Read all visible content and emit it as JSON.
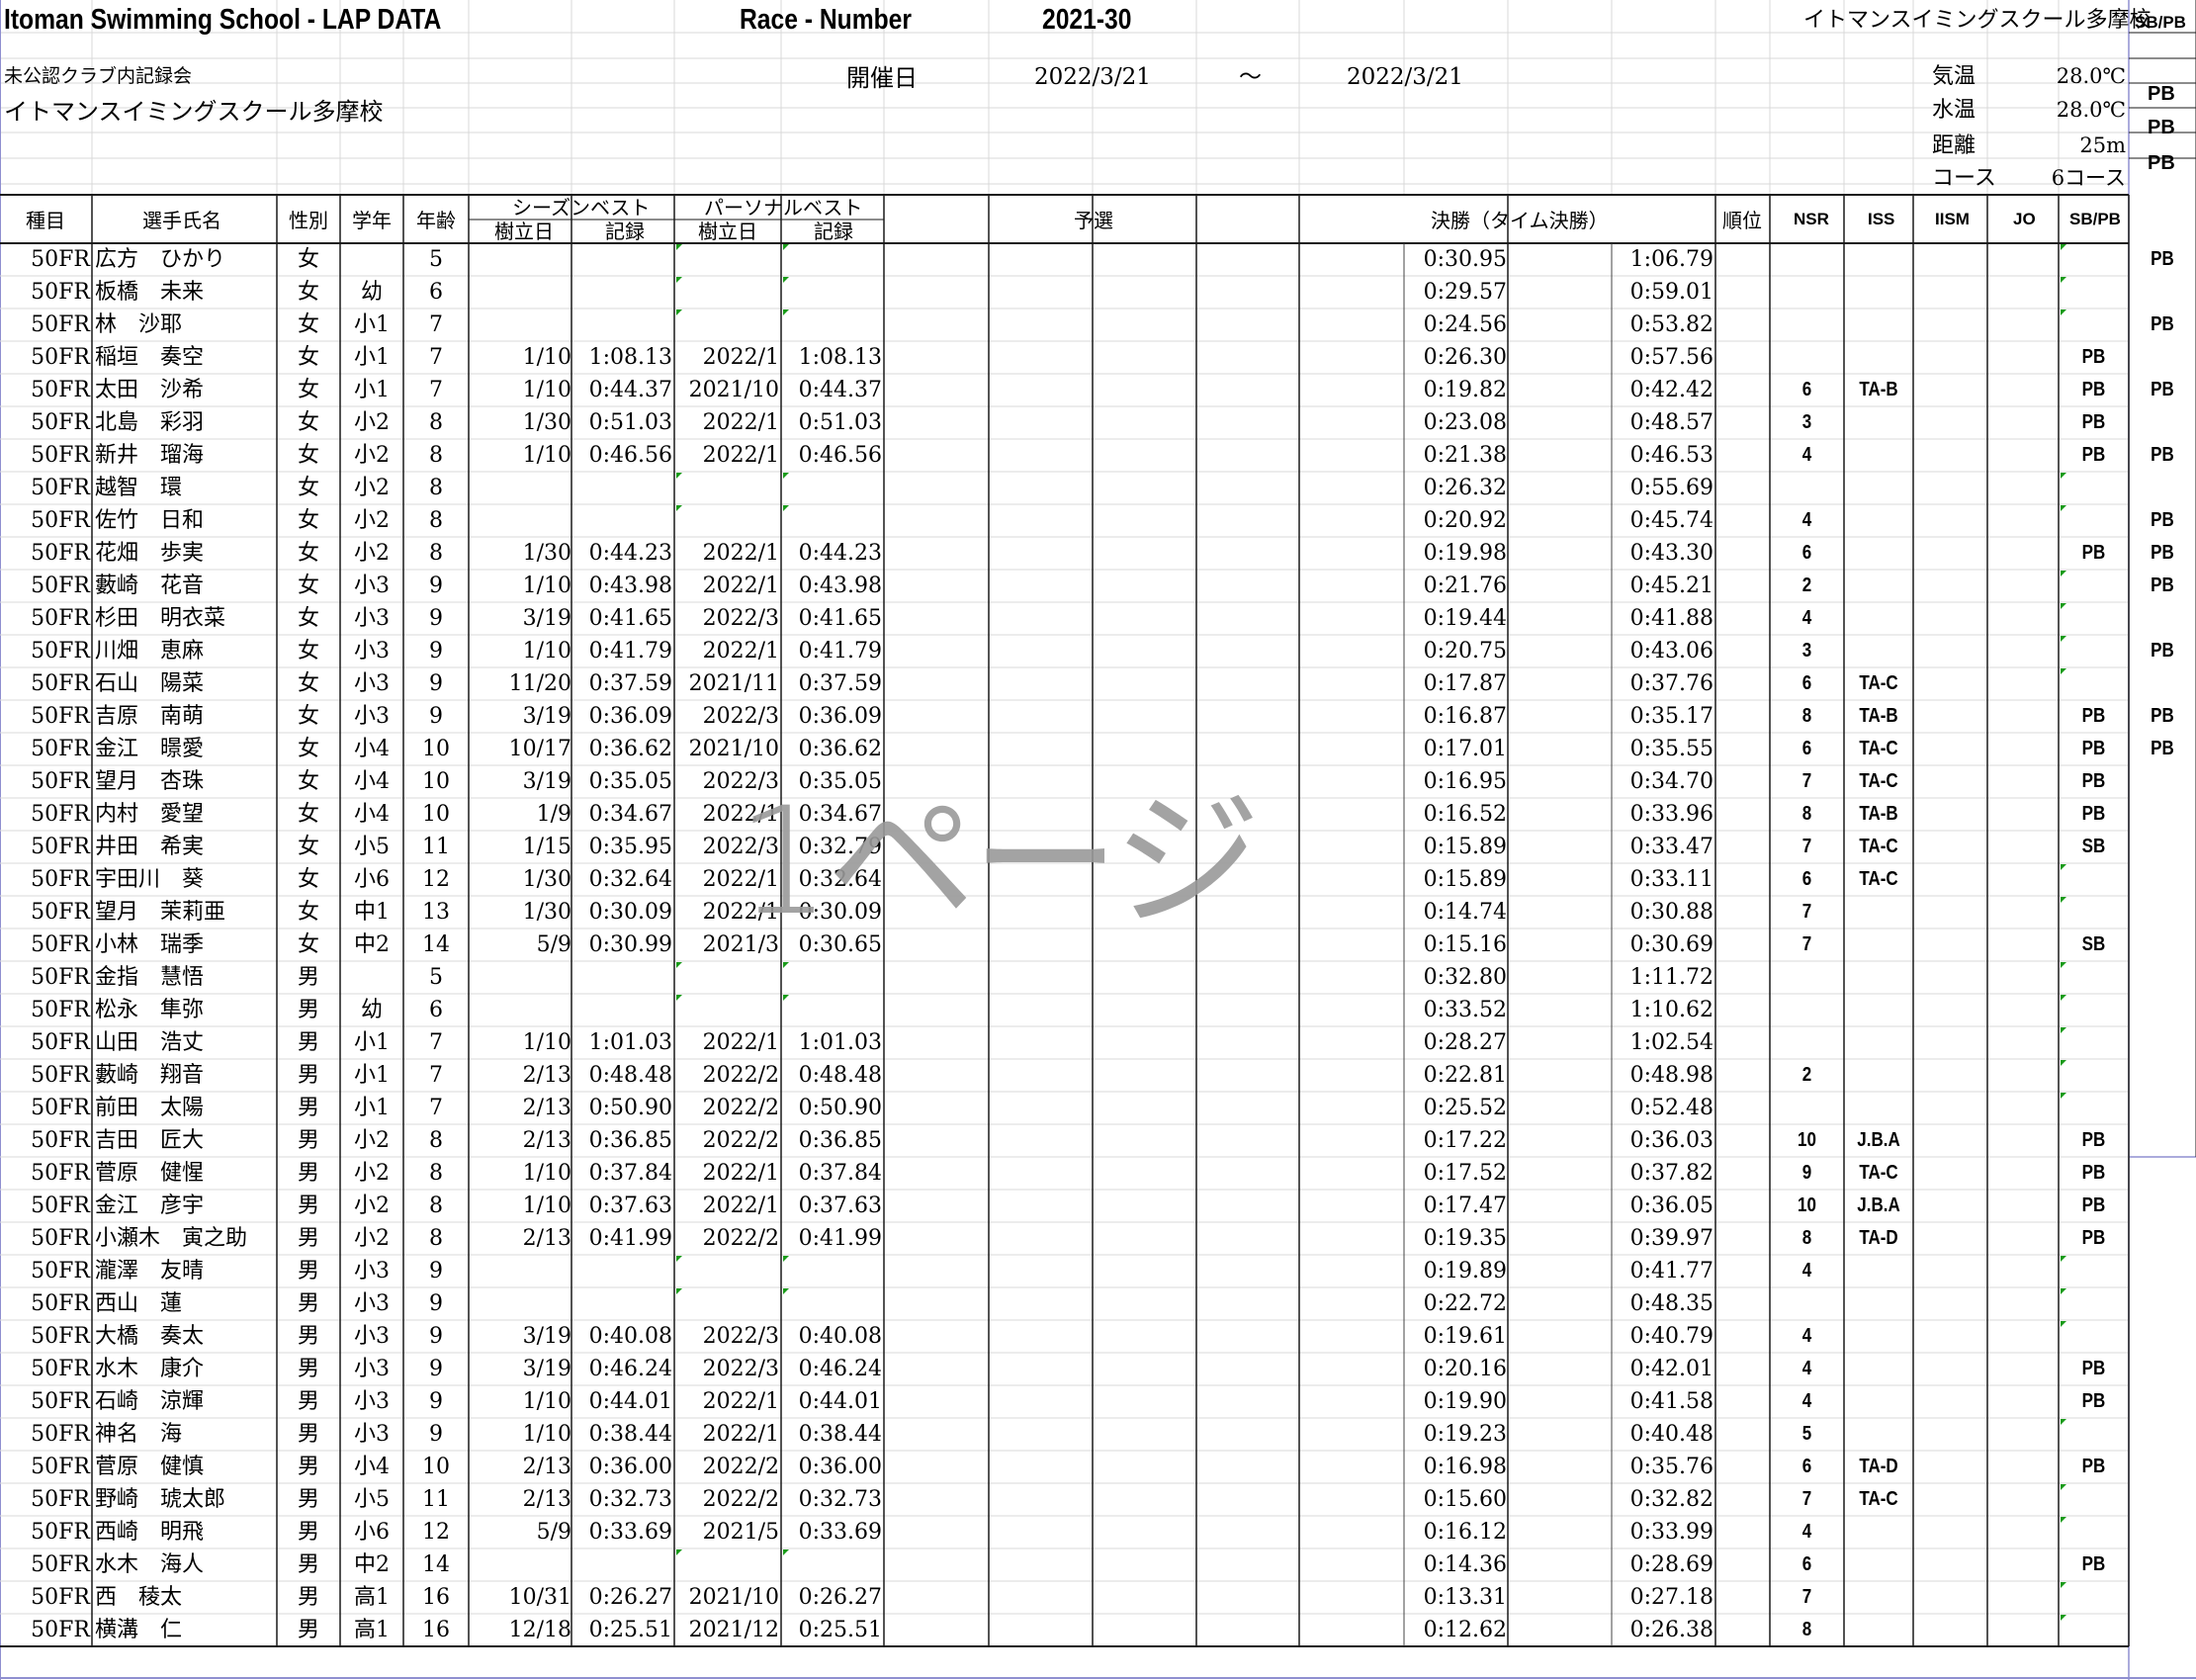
{
  "header": {
    "title": "Itoman Swimming School - LAP DATA",
    "race_label": "Race - Number",
    "race_number": "2021-30",
    "school_top_right": "イトマンスイミングスクール多摩校",
    "sbpb_label": "SB/PB",
    "meet_name": "未公認クラブ内記録会",
    "school_name": "イトマンスイミングスクール多摩校",
    "date_label": "開催日",
    "date_from": "2022/3/21",
    "tilde": "～",
    "date_to": "2022/3/21",
    "conditions": [
      {
        "label": "気温",
        "value": "28.0℃",
        "mark": "PB"
      },
      {
        "label": "水温",
        "value": "28.0℃",
        "mark": "PB"
      },
      {
        "label": "距離",
        "value": "25m",
        "mark": "PB"
      },
      {
        "label": "コース",
        "value": "6コース",
        "mark": ""
      }
    ]
  },
  "columns": {
    "event": "種目",
    "name": "選手氏名",
    "sex": "性別",
    "grade": "学年",
    "age": "年齢",
    "season_best": "シーズンベスト",
    "personal_best": "パーソナルベスト",
    "set_date": "樹立日",
    "record": "記録",
    "prelim": "予選",
    "final": "決勝（タイム決勝）",
    "rank": "順位",
    "nsr": "NSR",
    "iss": "ISS",
    "iism": "IISM",
    "jo": "JO",
    "sbpb": "SB/PB"
  },
  "watermark": "1ページ",
  "rows": [
    {
      "event": "50FR",
      "name": "広方　ひかり",
      "sex": "女",
      "grade": "",
      "age": "5",
      "sb_date": "",
      "sb_time": "",
      "pb_date": "",
      "pb_time": "",
      "split": "0:30.95",
      "final": "1:06.79",
      "nsr": "",
      "iss": "",
      "sbpb": "",
      "side": "PB"
    },
    {
      "event": "50FR",
      "name": "板橋　未来",
      "sex": "女",
      "grade": "幼",
      "age": "6",
      "sb_date": "",
      "sb_time": "",
      "pb_date": "",
      "pb_time": "",
      "split": "0:29.57",
      "final": "0:59.01",
      "nsr": "",
      "iss": "",
      "sbpb": "",
      "side": ""
    },
    {
      "event": "50FR",
      "name": "林　沙耶",
      "sex": "女",
      "grade": "小1",
      "age": "7",
      "sb_date": "",
      "sb_time": "",
      "pb_date": "",
      "pb_time": "",
      "split": "0:24.56",
      "final": "0:53.82",
      "nsr": "",
      "iss": "",
      "sbpb": "",
      "side": "PB"
    },
    {
      "event": "50FR",
      "name": "稲垣　奏空",
      "sex": "女",
      "grade": "小1",
      "age": "7",
      "sb_date": "1/10",
      "sb_time": "1:08.13",
      "pb_date": "2022/1",
      "pb_time": "1:08.13",
      "split": "0:26.30",
      "final": "0:57.56",
      "nsr": "",
      "iss": "",
      "sbpb": "PB",
      "side": ""
    },
    {
      "event": "50FR",
      "name": "太田　沙希",
      "sex": "女",
      "grade": "小1",
      "age": "7",
      "sb_date": "1/10",
      "sb_time": "0:44.37",
      "pb_date": "2021/10",
      "pb_time": "0:44.37",
      "split": "0:19.82",
      "final": "0:42.42",
      "nsr": "6",
      "iss": "TA-B",
      "sbpb": "PB",
      "side": "PB"
    },
    {
      "event": "50FR",
      "name": "北島　彩羽",
      "sex": "女",
      "grade": "小2",
      "age": "8",
      "sb_date": "1/30",
      "sb_time": "0:51.03",
      "pb_date": "2022/1",
      "pb_time": "0:51.03",
      "split": "0:23.08",
      "final": "0:48.57",
      "nsr": "3",
      "iss": "",
      "sbpb": "PB",
      "side": ""
    },
    {
      "event": "50FR",
      "name": "新井　瑠海",
      "sex": "女",
      "grade": "小2",
      "age": "8",
      "sb_date": "1/10",
      "sb_time": "0:46.56",
      "pb_date": "2022/1",
      "pb_time": "0:46.56",
      "split": "0:21.38",
      "final": "0:46.53",
      "nsr": "4",
      "iss": "",
      "sbpb": "PB",
      "side": "PB"
    },
    {
      "event": "50FR",
      "name": "越智　環",
      "sex": "女",
      "grade": "小2",
      "age": "8",
      "sb_date": "",
      "sb_time": "",
      "pb_date": "",
      "pb_time": "",
      "split": "0:26.32",
      "final": "0:55.69",
      "nsr": "",
      "iss": "",
      "sbpb": "",
      "side": ""
    },
    {
      "event": "50FR",
      "name": "佐竹　日和",
      "sex": "女",
      "grade": "小2",
      "age": "8",
      "sb_date": "",
      "sb_time": "",
      "pb_date": "",
      "pb_time": "",
      "split": "0:20.92",
      "final": "0:45.74",
      "nsr": "4",
      "iss": "",
      "sbpb": "",
      "side": "PB"
    },
    {
      "event": "50FR",
      "name": "花畑　歩実",
      "sex": "女",
      "grade": "小2",
      "age": "8",
      "sb_date": "1/30",
      "sb_time": "0:44.23",
      "pb_date": "2022/1",
      "pb_time": "0:44.23",
      "split": "0:19.98",
      "final": "0:43.30",
      "nsr": "6",
      "iss": "",
      "sbpb": "PB",
      "side": "PB"
    },
    {
      "event": "50FR",
      "name": "藪崎　花音",
      "sex": "女",
      "grade": "小3",
      "age": "9",
      "sb_date": "1/10",
      "sb_time": "0:43.98",
      "pb_date": "2022/1",
      "pb_time": "0:43.98",
      "split": "0:21.76",
      "final": "0:45.21",
      "nsr": "2",
      "iss": "",
      "sbpb": "",
      "side": "PB"
    },
    {
      "event": "50FR",
      "name": "杉田　明衣菜",
      "sex": "女",
      "grade": "小3",
      "age": "9",
      "sb_date": "3/19",
      "sb_time": "0:41.65",
      "pb_date": "2022/3",
      "pb_time": "0:41.65",
      "split": "0:19.44",
      "final": "0:41.88",
      "nsr": "4",
      "iss": "",
      "sbpb": "",
      "side": ""
    },
    {
      "event": "50FR",
      "name": "川畑　恵麻",
      "sex": "女",
      "grade": "小3",
      "age": "9",
      "sb_date": "1/10",
      "sb_time": "0:41.79",
      "pb_date": "2022/1",
      "pb_time": "0:41.79",
      "split": "0:20.75",
      "final": "0:43.06",
      "nsr": "3",
      "iss": "",
      "sbpb": "",
      "side": "PB"
    },
    {
      "event": "50FR",
      "name": "石山　陽菜",
      "sex": "女",
      "grade": "小3",
      "age": "9",
      "sb_date": "11/20",
      "sb_time": "0:37.59",
      "pb_date": "2021/11",
      "pb_time": "0:37.59",
      "split": "0:17.87",
      "final": "0:37.76",
      "nsr": "6",
      "iss": "TA-C",
      "sbpb": "",
      "side": ""
    },
    {
      "event": "50FR",
      "name": "吉原　南萌",
      "sex": "女",
      "grade": "小3",
      "age": "9",
      "sb_date": "3/19",
      "sb_time": "0:36.09",
      "pb_date": "2022/3",
      "pb_time": "0:36.09",
      "split": "0:16.87",
      "final": "0:35.17",
      "nsr": "8",
      "iss": "TA-B",
      "sbpb": "PB",
      "side": "PB"
    },
    {
      "event": "50FR",
      "name": "金江　暻愛",
      "sex": "女",
      "grade": "小4",
      "age": "10",
      "sb_date": "10/17",
      "sb_time": "0:36.62",
      "pb_date": "2021/10",
      "pb_time": "0:36.62",
      "split": "0:17.01",
      "final": "0:35.55",
      "nsr": "6",
      "iss": "TA-C",
      "sbpb": "PB",
      "side": "PB"
    },
    {
      "event": "50FR",
      "name": "望月　杏珠",
      "sex": "女",
      "grade": "小4",
      "age": "10",
      "sb_date": "3/19",
      "sb_time": "0:35.05",
      "pb_date": "2022/3",
      "pb_time": "0:35.05",
      "split": "0:16.95",
      "final": "0:34.70",
      "nsr": "7",
      "iss": "TA-C",
      "sbpb": "PB",
      "side": ""
    },
    {
      "event": "50FR",
      "name": "内村　愛望",
      "sex": "女",
      "grade": "小4",
      "age": "10",
      "sb_date": "1/9",
      "sb_time": "0:34.67",
      "pb_date": "2022/1",
      "pb_time": "0:34.67",
      "split": "0:16.52",
      "final": "0:33.96",
      "nsr": "8",
      "iss": "TA-B",
      "sbpb": "PB",
      "side": ""
    },
    {
      "event": "50FR",
      "name": "井田　希実",
      "sex": "女",
      "grade": "小5",
      "age": "11",
      "sb_date": "1/15",
      "sb_time": "0:35.95",
      "pb_date": "2022/3",
      "pb_time": "0:32.79",
      "split": "0:15.89",
      "final": "0:33.47",
      "nsr": "7",
      "iss": "TA-C",
      "sbpb": "SB",
      "side": ""
    },
    {
      "event": "50FR",
      "name": "宇田川　葵",
      "sex": "女",
      "grade": "小6",
      "age": "12",
      "sb_date": "1/30",
      "sb_time": "0:32.64",
      "pb_date": "2022/1",
      "pb_time": "0:32.64",
      "split": "0:15.89",
      "final": "0:33.11",
      "nsr": "6",
      "iss": "TA-C",
      "sbpb": "",
      "side": ""
    },
    {
      "event": "50FR",
      "name": "望月　茉莉亜",
      "sex": "女",
      "grade": "中1",
      "age": "13",
      "sb_date": "1/30",
      "sb_time": "0:30.09",
      "pb_date": "2022/1",
      "pb_time": "0:30.09",
      "split": "0:14.74",
      "final": "0:30.88",
      "nsr": "7",
      "iss": "",
      "sbpb": "",
      "side": ""
    },
    {
      "event": "50FR",
      "name": "小林　瑞季",
      "sex": "女",
      "grade": "中2",
      "age": "14",
      "sb_date": "5/9",
      "sb_time": "0:30.99",
      "pb_date": "2021/3",
      "pb_time": "0:30.65",
      "split": "0:15.16",
      "final": "0:30.69",
      "nsr": "7",
      "iss": "",
      "sbpb": "SB",
      "side": ""
    },
    {
      "event": "50FR",
      "name": "金指　慧悟",
      "sex": "男",
      "grade": "",
      "age": "5",
      "sb_date": "",
      "sb_time": "",
      "pb_date": "",
      "pb_time": "",
      "split": "0:32.80",
      "final": "1:11.72",
      "nsr": "",
      "iss": "",
      "sbpb": "",
      "side": ""
    },
    {
      "event": "50FR",
      "name": "松永　隼弥",
      "sex": "男",
      "grade": "幼",
      "age": "6",
      "sb_date": "",
      "sb_time": "",
      "pb_date": "",
      "pb_time": "",
      "split": "0:33.52",
      "final": "1:10.62",
      "nsr": "",
      "iss": "",
      "sbpb": "",
      "side": ""
    },
    {
      "event": "50FR",
      "name": "山田　浩丈",
      "sex": "男",
      "grade": "小1",
      "age": "7",
      "sb_date": "1/10",
      "sb_time": "1:01.03",
      "pb_date": "2022/1",
      "pb_time": "1:01.03",
      "split": "0:28.27",
      "final": "1:02.54",
      "nsr": "",
      "iss": "",
      "sbpb": "",
      "side": ""
    },
    {
      "event": "50FR",
      "name": "藪崎　翔音",
      "sex": "男",
      "grade": "小1",
      "age": "7",
      "sb_date": "2/13",
      "sb_time": "0:48.48",
      "pb_date": "2022/2",
      "pb_time": "0:48.48",
      "split": "0:22.81",
      "final": "0:48.98",
      "nsr": "2",
      "iss": "",
      "sbpb": "",
      "side": ""
    },
    {
      "event": "50FR",
      "name": "前田　太陽",
      "sex": "男",
      "grade": "小1",
      "age": "7",
      "sb_date": "2/13",
      "sb_time": "0:50.90",
      "pb_date": "2022/2",
      "pb_time": "0:50.90",
      "split": "0:25.52",
      "final": "0:52.48",
      "nsr": "",
      "iss": "",
      "sbpb": "",
      "side": ""
    },
    {
      "event": "50FR",
      "name": "吉田　匠大",
      "sex": "男",
      "grade": "小2",
      "age": "8",
      "sb_date": "2/13",
      "sb_time": "0:36.85",
      "pb_date": "2022/2",
      "pb_time": "0:36.85",
      "split": "0:17.22",
      "final": "0:36.03",
      "nsr": "10",
      "iss": "J.B.A",
      "sbpb": "PB",
      "side": ""
    },
    {
      "event": "50FR",
      "name": "菅原　健惺",
      "sex": "男",
      "grade": "小2",
      "age": "8",
      "sb_date": "1/10",
      "sb_time": "0:37.84",
      "pb_date": "2022/1",
      "pb_time": "0:37.84",
      "split": "0:17.52",
      "final": "0:37.82",
      "nsr": "9",
      "iss": "TA-C",
      "sbpb": "PB",
      "side": ""
    },
    {
      "event": "50FR",
      "name": "金江　彦宇",
      "sex": "男",
      "grade": "小2",
      "age": "8",
      "sb_date": "1/10",
      "sb_time": "0:37.63",
      "pb_date": "2022/1",
      "pb_time": "0:37.63",
      "split": "0:17.47",
      "final": "0:36.05",
      "nsr": "10",
      "iss": "J.B.A",
      "sbpb": "PB",
      "side": ""
    },
    {
      "event": "50FR",
      "name": "小瀬木　寅之助",
      "sex": "男",
      "grade": "小2",
      "age": "8",
      "sb_date": "2/13",
      "sb_time": "0:41.99",
      "pb_date": "2022/2",
      "pb_time": "0:41.99",
      "split": "0:19.35",
      "final": "0:39.97",
      "nsr": "8",
      "iss": "TA-D",
      "sbpb": "PB",
      "side": ""
    },
    {
      "event": "50FR",
      "name": "瀧澤　友晴",
      "sex": "男",
      "grade": "小3",
      "age": "9",
      "sb_date": "",
      "sb_time": "",
      "pb_date": "",
      "pb_time": "",
      "split": "0:19.89",
      "final": "0:41.77",
      "nsr": "4",
      "iss": "",
      "sbpb": "",
      "side": ""
    },
    {
      "event": "50FR",
      "name": "西山　蓮",
      "sex": "男",
      "grade": "小3",
      "age": "9",
      "sb_date": "",
      "sb_time": "",
      "pb_date": "",
      "pb_time": "",
      "split": "0:22.72",
      "final": "0:48.35",
      "nsr": "",
      "iss": "",
      "sbpb": "",
      "side": ""
    },
    {
      "event": "50FR",
      "name": "大橋　奏太",
      "sex": "男",
      "grade": "小3",
      "age": "9",
      "sb_date": "3/19",
      "sb_time": "0:40.08",
      "pb_date": "2022/3",
      "pb_time": "0:40.08",
      "split": "0:19.61",
      "final": "0:40.79",
      "nsr": "4",
      "iss": "",
      "sbpb": "",
      "side": ""
    },
    {
      "event": "50FR",
      "name": "水木　康介",
      "sex": "男",
      "grade": "小3",
      "age": "9",
      "sb_date": "3/19",
      "sb_time": "0:46.24",
      "pb_date": "2022/3",
      "pb_time": "0:46.24",
      "split": "0:20.16",
      "final": "0:42.01",
      "nsr": "4",
      "iss": "",
      "sbpb": "PB",
      "side": ""
    },
    {
      "event": "50FR",
      "name": "石崎　涼輝",
      "sex": "男",
      "grade": "小3",
      "age": "9",
      "sb_date": "1/10",
      "sb_time": "0:44.01",
      "pb_date": "2022/1",
      "pb_time": "0:44.01",
      "split": "0:19.90",
      "final": "0:41.58",
      "nsr": "4",
      "iss": "",
      "sbpb": "PB",
      "side": ""
    },
    {
      "event": "50FR",
      "name": "神名　海",
      "sex": "男",
      "grade": "小3",
      "age": "9",
      "sb_date": "1/10",
      "sb_time": "0:38.44",
      "pb_date": "2022/1",
      "pb_time": "0:38.44",
      "split": "0:19.23",
      "final": "0:40.48",
      "nsr": "5",
      "iss": "",
      "sbpb": "",
      "side": ""
    },
    {
      "event": "50FR",
      "name": "菅原　健慎",
      "sex": "男",
      "grade": "小4",
      "age": "10",
      "sb_date": "2/13",
      "sb_time": "0:36.00",
      "pb_date": "2022/2",
      "pb_time": "0:36.00",
      "split": "0:16.98",
      "final": "0:35.76",
      "nsr": "6",
      "iss": "TA-D",
      "sbpb": "PB",
      "side": ""
    },
    {
      "event": "50FR",
      "name": "野崎　琥太郎",
      "sex": "男",
      "grade": "小5",
      "age": "11",
      "sb_date": "2/13",
      "sb_time": "0:32.73",
      "pb_date": "2022/2",
      "pb_time": "0:32.73",
      "split": "0:15.60",
      "final": "0:32.82",
      "nsr": "7",
      "iss": "TA-C",
      "sbpb": "",
      "side": ""
    },
    {
      "event": "50FR",
      "name": "西崎　明飛",
      "sex": "男",
      "grade": "小6",
      "age": "12",
      "sb_date": "5/9",
      "sb_time": "0:33.69",
      "pb_date": "2021/5",
      "pb_time": "0:33.69",
      "split": "0:16.12",
      "final": "0:33.99",
      "nsr": "4",
      "iss": "",
      "sbpb": "",
      "side": ""
    },
    {
      "event": "50FR",
      "name": "水木　海人",
      "sex": "男",
      "grade": "中2",
      "age": "14",
      "sb_date": "",
      "sb_time": "",
      "pb_date": "",
      "pb_time": "",
      "split": "0:14.36",
      "final": "0:28.69",
      "nsr": "6",
      "iss": "",
      "sbpb": "PB",
      "side": ""
    },
    {
      "event": "50FR",
      "name": "西　稜太",
      "sex": "男",
      "grade": "高1",
      "age": "16",
      "sb_date": "10/31",
      "sb_time": "0:26.27",
      "pb_date": "2021/10",
      "pb_time": "0:26.27",
      "split": "0:13.31",
      "final": "0:27.18",
      "nsr": "7",
      "iss": "",
      "sbpb": "",
      "side": ""
    },
    {
      "event": "50FR",
      "name": "横溝　仁",
      "sex": "男",
      "grade": "高1",
      "age": "16",
      "sb_date": "12/18",
      "sb_time": "0:25.51",
      "pb_date": "2021/12",
      "pb_time": "0:25.51",
      "split": "0:12.62",
      "final": "0:26.38",
      "nsr": "8",
      "iss": "",
      "sbpb": "",
      "side": ""
    }
  ]
}
